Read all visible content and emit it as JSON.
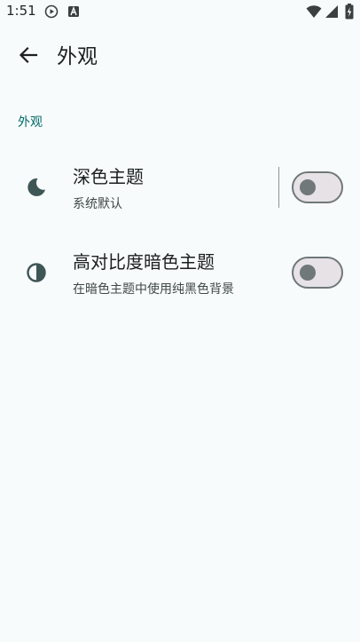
{
  "status_bar": {
    "time": "1:51"
  },
  "app_bar": {
    "title": "外观"
  },
  "section": {
    "header": "外观"
  },
  "settings": [
    {
      "title": "深色主题",
      "subtitle": "系统默认",
      "icon": "moon-icon",
      "enabled": false
    },
    {
      "title": "高对比度暗色主题",
      "subtitle": "在暗色主题中使用纯黑色背景",
      "icon": "contrast-icon",
      "enabled": false
    }
  ],
  "colors": {
    "accent": "#006a6a",
    "background": "#f8fbfb",
    "icon": "#3f5656",
    "switch_track": "#e6e2e6",
    "switch_outline": "#707879"
  }
}
